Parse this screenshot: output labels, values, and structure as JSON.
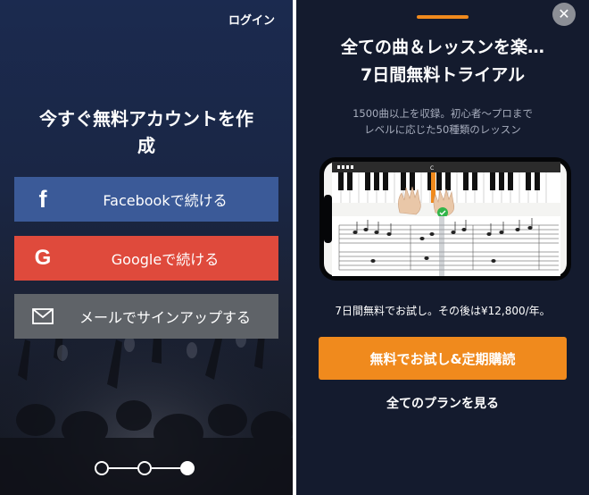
{
  "signup_screen": {
    "login_link": "ログイン",
    "title_line1": "今すぐ無料アカウントを作",
    "title_line2": "成",
    "buttons": [
      {
        "icon": "facebook-icon",
        "label": "Facebookで続ける",
        "color": "#3b5a98"
      },
      {
        "icon": "google-icon",
        "label": "Googleで続ける",
        "color": "#df4a3c"
      },
      {
        "icon": "mail-icon",
        "label": "メールでサインアップする",
        "color": "#5f6368"
      }
    ],
    "pager": {
      "total": 3,
      "current": 3
    }
  },
  "trial_screen": {
    "title_line1": "全ての曲＆レッスンを楽…",
    "title_line2": "7日間無料トライアル",
    "description_line1": "1500曲以上を収録。初心者〜プロまで",
    "description_line2": "レベルに応じた50種類のレッスン",
    "preview_key_label": "C",
    "trial_note": "7日間無料でお試し。その後は¥12,800/年。",
    "cta_label": "無料でお試し&定期購読",
    "see_plans_label": "全てのプランを見る",
    "accent_color": "#f08a1d",
    "background_color": "#141b2e"
  }
}
